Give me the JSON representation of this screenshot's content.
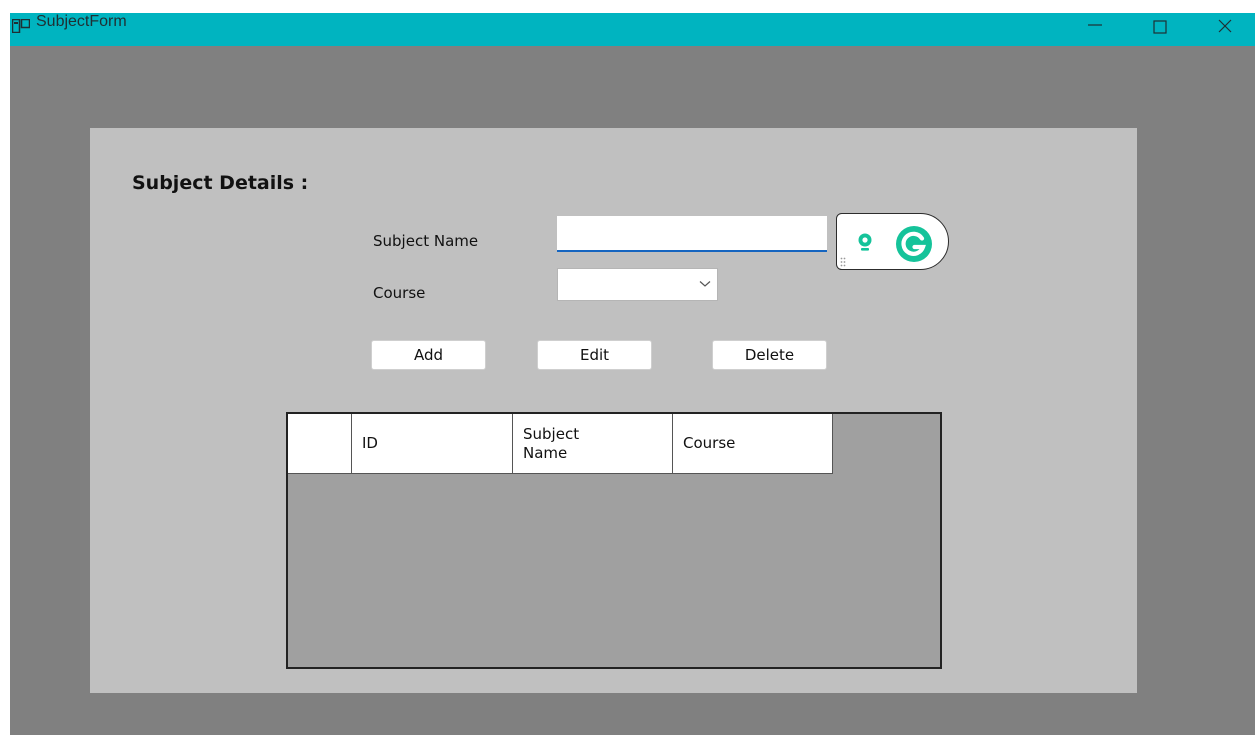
{
  "window": {
    "title": "SubjectForm",
    "titlebar_color": "#00b4c0"
  },
  "form": {
    "heading": "Subject Details :",
    "subject_name_label": "Subject Name",
    "subject_name_value": "",
    "course_label": "Course",
    "course_value": ""
  },
  "buttons": {
    "add": "Add",
    "edit": "Edit",
    "delete": "Delete"
  },
  "grid": {
    "columns": [
      "",
      "ID",
      "Subject Name",
      "Course"
    ],
    "rows": []
  },
  "colors": {
    "window_background": "#808080",
    "panel_background": "#c0c0c0",
    "grid_background": "#a0a0a0",
    "input_focus": "#1565c0",
    "grammarly": "#15c39a"
  }
}
